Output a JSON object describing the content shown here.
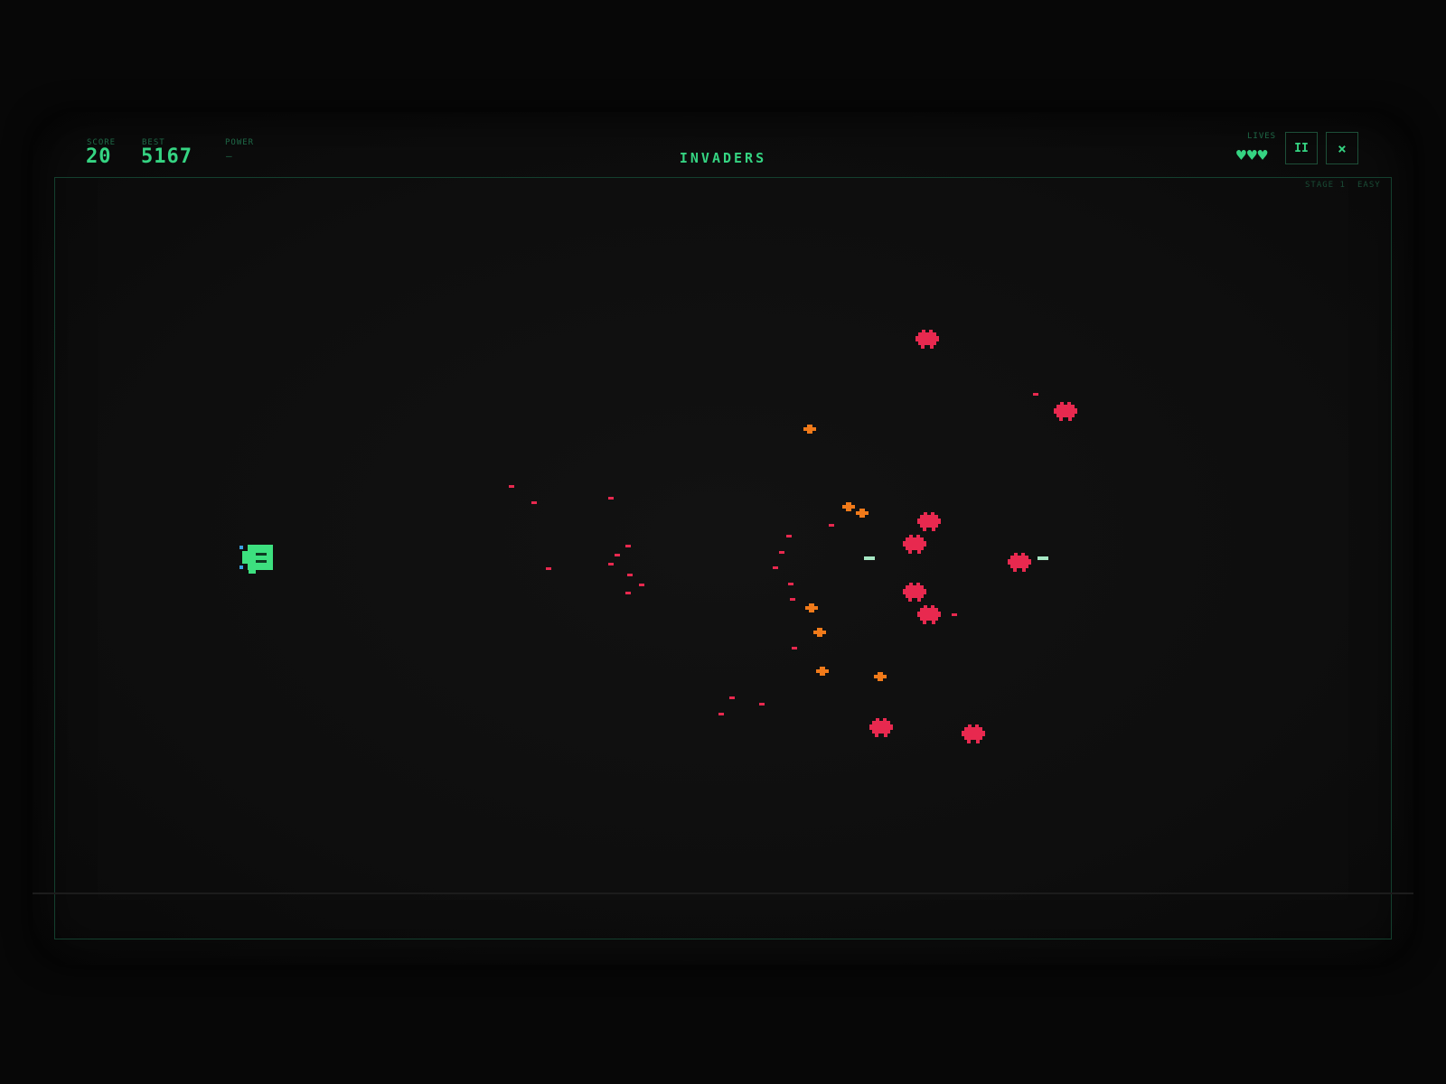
{
  "hud": {
    "score_label": "SCORE",
    "score_value": "20",
    "best_label": "BEST",
    "best_value": "5167",
    "power_label": "POWER",
    "power_value": "–",
    "title": "INVADERS",
    "lives_label": "LIVES",
    "lives_icons": "♥♥♥",
    "pause_label": "II",
    "close_label": "×",
    "stage_label": "STAGE 1",
    "difficulty_label": "EASY"
  },
  "game_state": {
    "score": 20,
    "best": 5167,
    "lives": 3,
    "stage": 1
  },
  "colors": {
    "accent_green": "#35d482",
    "enemy_red": "#e8294f",
    "powerup_orange": "#f07a1a",
    "player_green": "#3de07f",
    "player_blue": "#3aa0e0",
    "player_bullet": "#a6e8c4"
  },
  "icons": {
    "lives": "heart-icon",
    "pause": "pause-icon",
    "close": "close-icon"
  }
}
